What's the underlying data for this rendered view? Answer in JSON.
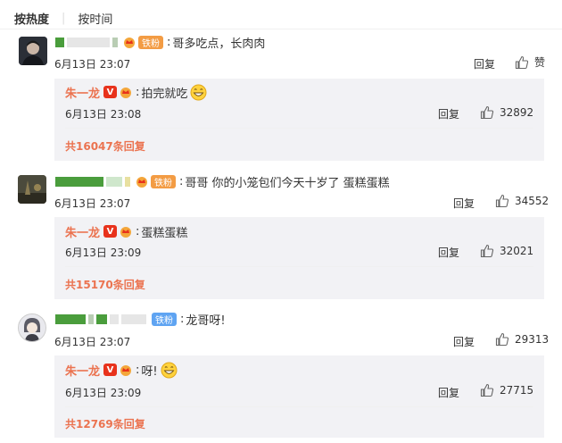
{
  "tabs": {
    "hot": "按热度",
    "time": "按时间"
  },
  "comments": [
    {
      "text": "哥多吃点，长肉肉",
      "time": "6月13日 23:07",
      "reply_label": "回复",
      "like_label": "赞",
      "fan_badge": "铁粉",
      "reply": {
        "name": "朱一龙",
        "text": "拍完就吃",
        "time": "6月13日 23:08",
        "reply_label": "回复",
        "likes": "32892"
      },
      "more": "共16047条回复"
    },
    {
      "text": "哥哥 你的小笼包们今天十岁了 蛋糕蛋糕",
      "time": "6月13日 23:07",
      "reply_label": "回复",
      "likes": "34552",
      "fan_badge": "铁粉",
      "reply": {
        "name": "朱一龙",
        "text": "蛋糕蛋糕",
        "time": "6月13日 23:09",
        "reply_label": "回复",
        "likes": "32021"
      },
      "more": "共15170条回复"
    },
    {
      "text": "龙哥呀!",
      "time": "6月13日 23:07",
      "reply_label": "回复",
      "likes": "29313",
      "fan_badge": "铁粉",
      "reply": {
        "name": "朱一龙",
        "text": "呀!",
        "time": "6月13日 23:09",
        "reply_label": "回复",
        "likes": "27715"
      },
      "more": "共12769条回复"
    }
  ],
  "verified_badge": "V",
  "colors": {
    "name": "#eb7350",
    "reply_bg": "#f2f2f5",
    "verified": "#e8321c",
    "fan_orange": "#f39c44",
    "fan_blue": "#5fa4f2"
  },
  "icons": {
    "thumb": "thumbs-up-icon",
    "crown": "crown-icon",
    "grin": "grin-emoji-icon"
  }
}
